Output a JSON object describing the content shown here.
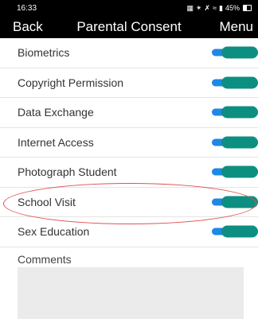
{
  "status_bar": {
    "time": "16:33",
    "icons": [
      "nfc-icon",
      "bluetooth-icon",
      "mute-icon",
      "wifi-icon",
      "signal-icon"
    ],
    "battery": "45%"
  },
  "nav": {
    "back_label": "Back",
    "title": "Parental Consent",
    "menu_label": "Menu"
  },
  "consents": [
    {
      "label": "Biometrics",
      "on": true
    },
    {
      "label": "Copyright Permission",
      "on": true
    },
    {
      "label": "Data Exchange",
      "on": true
    },
    {
      "label": "Internet Access",
      "on": true
    },
    {
      "label": "Photograph Student",
      "on": true
    },
    {
      "label": "School Visit",
      "on": true
    },
    {
      "label": "Sex Education",
      "on": true
    }
  ],
  "comments": {
    "label": "Comments",
    "value": ""
  },
  "colors": {
    "bar_bg": "#000000",
    "toggle_track": "#1e88e5",
    "toggle_knob": "#0c8f80",
    "highlight": "#e05050",
    "comments_bg": "#ebebeb"
  }
}
